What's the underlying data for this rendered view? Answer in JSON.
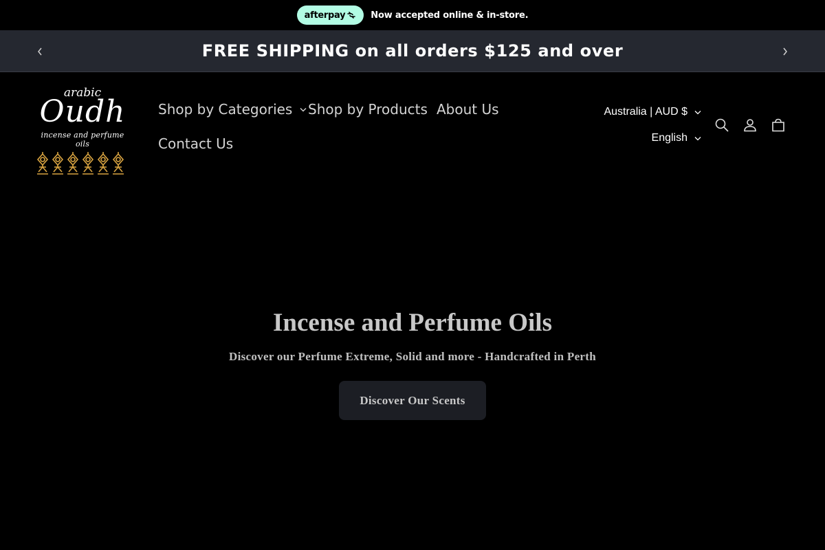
{
  "promo": {
    "afterpay_label": "afterpay",
    "text": "Now accepted online & in-store."
  },
  "announcement": {
    "text": "FREE SHIPPING on all orders $125 and over",
    "prev_icon": "chevron-left-icon",
    "next_icon": "chevron-right-icon"
  },
  "logo": {
    "top": "arabic",
    "main": "Oudh",
    "sub": "incense and perfume oils"
  },
  "nav": {
    "items": [
      {
        "label": "Shop by Categories",
        "has_dropdown": true
      },
      {
        "label": "Shop by Products"
      },
      {
        "label": "About Us"
      },
      {
        "label": "Contact Us"
      }
    ]
  },
  "selectors": {
    "country": "Australia | AUD $",
    "language": "English"
  },
  "header_icons": [
    "search-icon",
    "account-icon",
    "cart-icon"
  ],
  "hero": {
    "title": "Incense and Perfume Oils",
    "subtitle": "Discover our Perfume Extreme, Solid and more - Handcrafted in Perth",
    "button": "Discover Our Scents"
  },
  "colors": {
    "background": "#000000",
    "announcement_bg": "#252830",
    "afterpay_mint": "#b2fce4",
    "button_bg": "#1c1e24",
    "logo_gold": "#d9a441"
  }
}
